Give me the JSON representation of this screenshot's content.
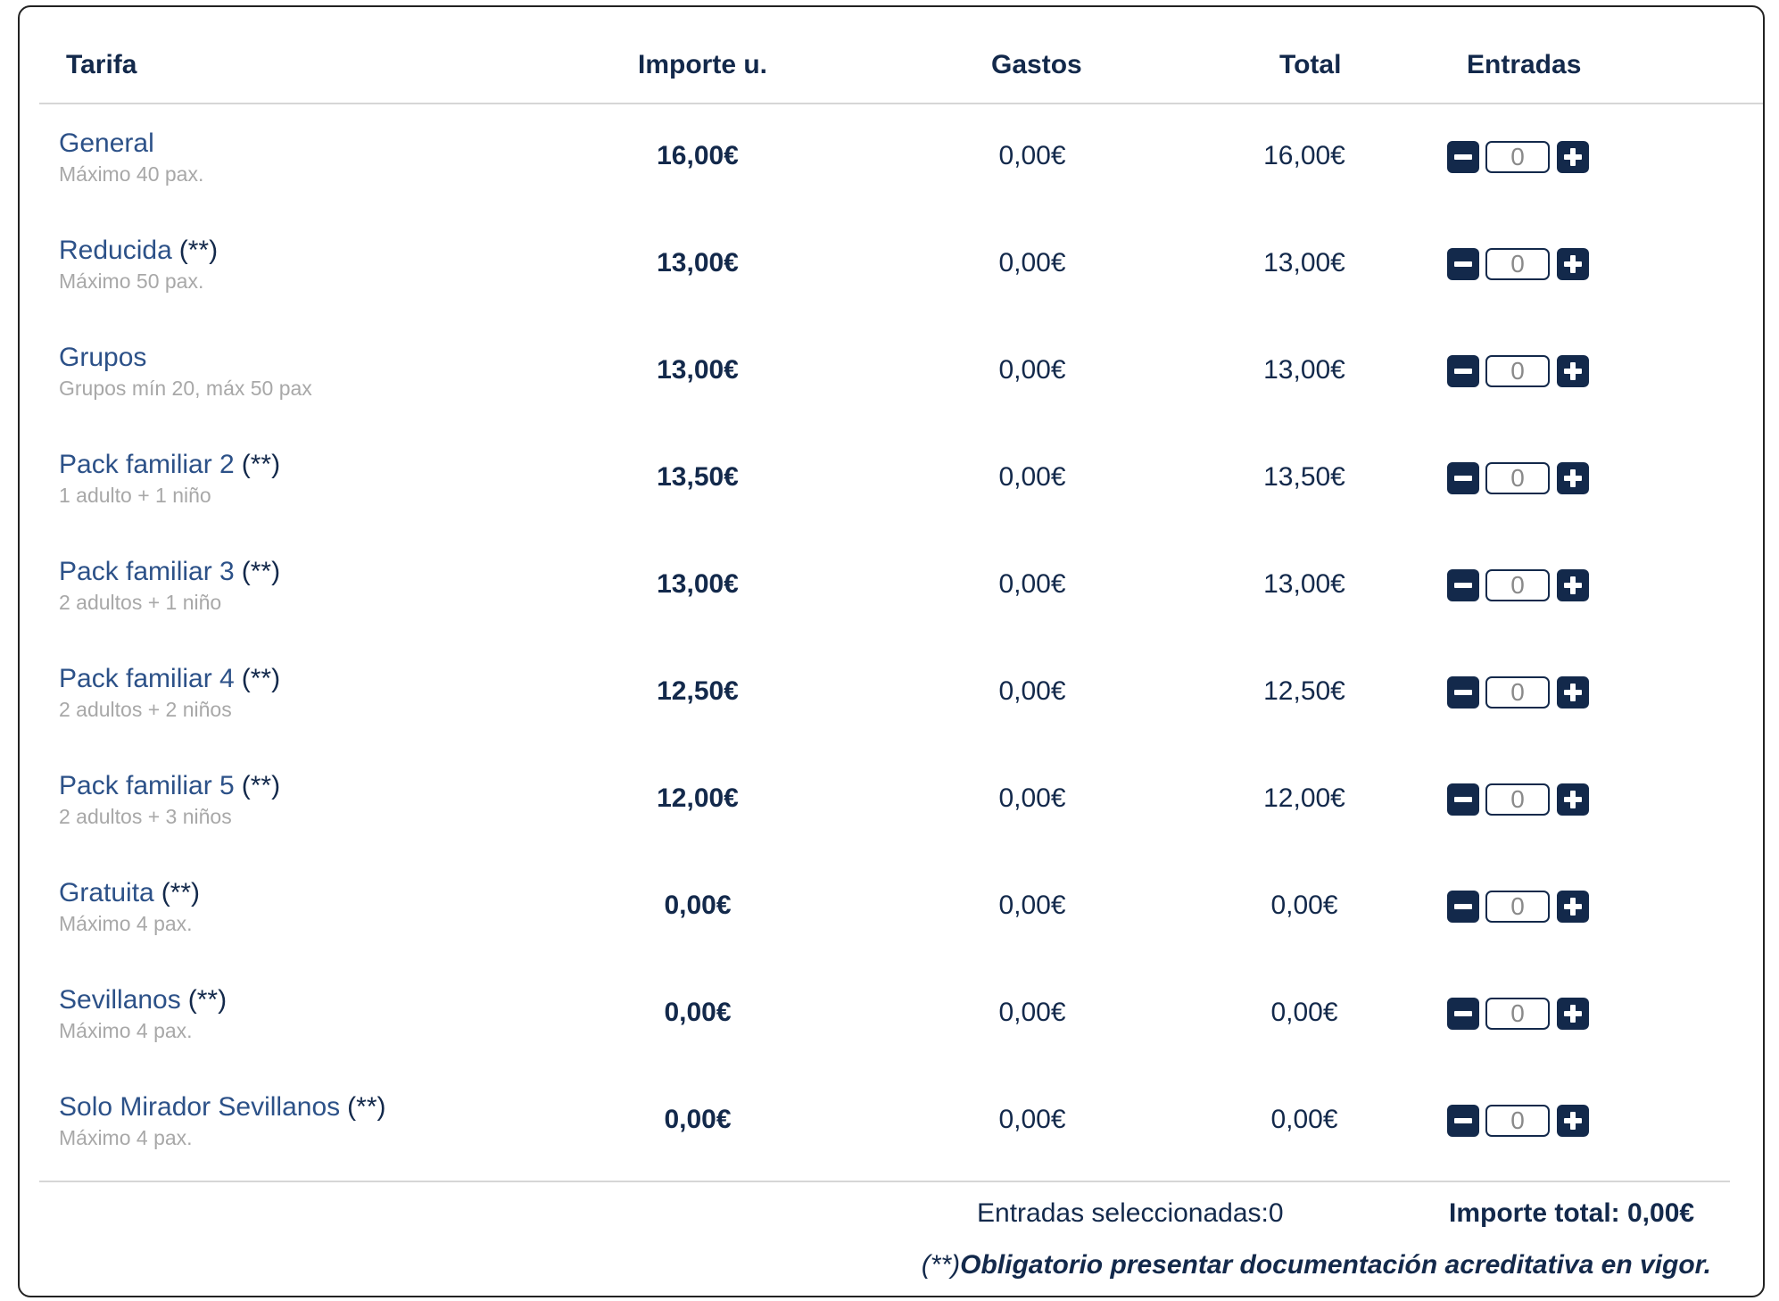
{
  "table": {
    "headers": {
      "tarifa": "Tarifa",
      "importe": "Importe u.",
      "gastos": "Gastos",
      "total": "Total",
      "entradas": "Entradas"
    },
    "rows": [
      {
        "name": "General",
        "note": "",
        "sub": "Máximo 40 pax.",
        "importe": "16,00€",
        "gastos": "0,00€",
        "total": "16,00€",
        "qty": "0"
      },
      {
        "name": "Reducida",
        "note": "(**)",
        "sub": "Máximo 50 pax.",
        "importe": "13,00€",
        "gastos": "0,00€",
        "total": "13,00€",
        "qty": "0"
      },
      {
        "name": "Grupos",
        "note": "",
        "sub": "Grupos mín 20, máx 50 pax",
        "importe": "13,00€",
        "gastos": "0,00€",
        "total": "13,00€",
        "qty": "0"
      },
      {
        "name": "Pack familiar 2",
        "note": "(**)",
        "sub": "1 adulto + 1 niño",
        "importe": "13,50€",
        "gastos": "0,00€",
        "total": "13,50€",
        "qty": "0"
      },
      {
        "name": "Pack familiar 3",
        "note": "(**)",
        "sub": "2 adultos + 1 niño",
        "importe": "13,00€",
        "gastos": "0,00€",
        "total": "13,00€",
        "qty": "0"
      },
      {
        "name": "Pack familiar 4",
        "note": "(**)",
        "sub": "2 adultos + 2 niños",
        "importe": "12,50€",
        "gastos": "0,00€",
        "total": "12,50€",
        "qty": "0"
      },
      {
        "name": "Pack familiar 5",
        "note": "(**)",
        "sub": "2 adultos + 3 niños",
        "importe": "12,00€",
        "gastos": "0,00€",
        "total": "12,00€",
        "qty": "0"
      },
      {
        "name": "Gratuita",
        "note": "(**)",
        "sub": "Máximo 4 pax.",
        "importe": "0,00€",
        "gastos": "0,00€",
        "total": "0,00€",
        "qty": "0"
      },
      {
        "name": "Sevillanos",
        "note": "(**)",
        "sub": "Máximo 4 pax.",
        "importe": "0,00€",
        "gastos": "0,00€",
        "total": "0,00€",
        "qty": "0"
      },
      {
        "name": "Solo Mirador Sevillanos",
        "note": "(**)",
        "sub": "Máximo 4 pax.",
        "importe": "0,00€",
        "gastos": "0,00€",
        "total": "0,00€",
        "qty": "0"
      }
    ]
  },
  "summary": {
    "selected": "Entradas seleccionadas:0",
    "total": "Importe total: 0,00€"
  },
  "footnote": {
    "prefix": "(**)",
    "text": "Obligatorio presentar documentación acreditativa en vigor."
  },
  "icons": {
    "minus": "minus-icon",
    "plus": "plus-icon"
  },
  "colors": {
    "navy": "#13294b",
    "link_blue": "#2c5188",
    "muted": "#a8a8a8"
  }
}
